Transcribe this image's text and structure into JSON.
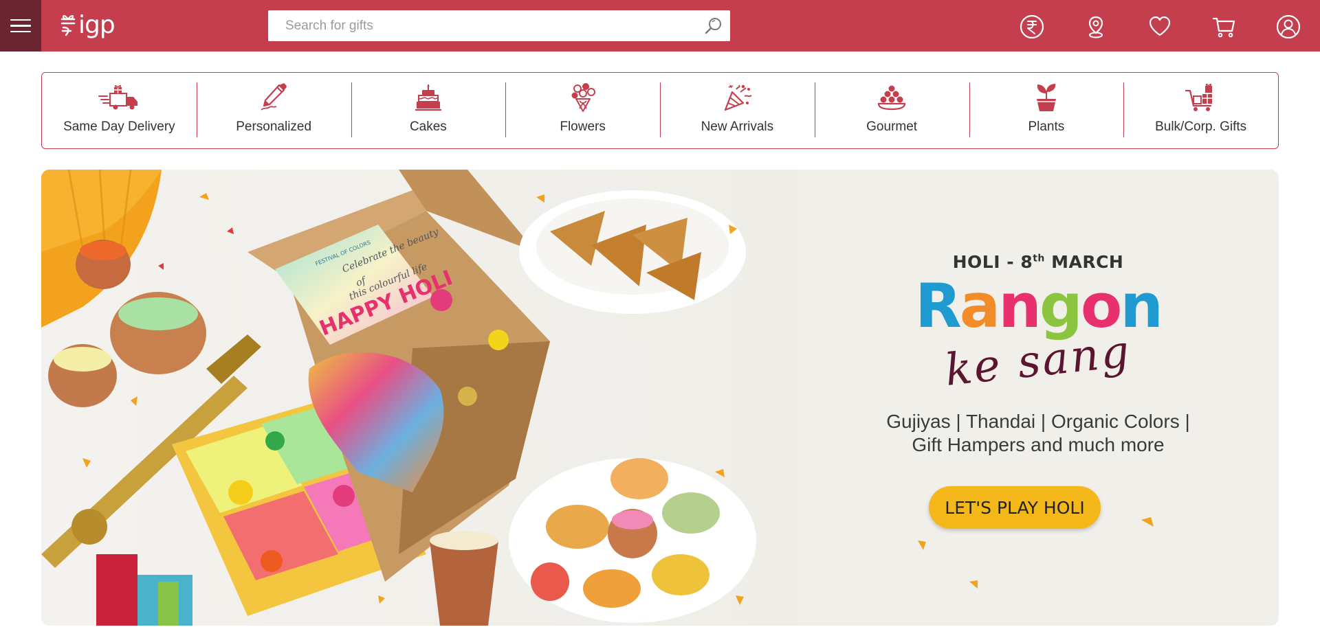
{
  "header": {
    "logo_text": "igp",
    "search": {
      "placeholder": "Search for gifts",
      "value": ""
    },
    "icons": [
      "menu-icon",
      "search-icon",
      "rupee-currency-icon",
      "location-pin-icon",
      "heart-icon",
      "cart-icon",
      "user-account-icon"
    ]
  },
  "categories": [
    {
      "label": "Same Day Delivery",
      "icon": "delivery-truck-icon"
    },
    {
      "label": "Personalized",
      "icon": "pencil-icon"
    },
    {
      "label": "Cakes",
      "icon": "cake-icon"
    },
    {
      "label": "Flowers",
      "icon": "bouquet-icon"
    },
    {
      "label": "New Arrivals",
      "icon": "party-popper-icon"
    },
    {
      "label": "Gourmet",
      "icon": "sweets-platter-icon"
    },
    {
      "label": "Plants",
      "icon": "potted-plant-icon"
    },
    {
      "label": "Bulk/Corp. Gifts",
      "icon": "gift-cart-icon"
    }
  ],
  "banner": {
    "date_line": "HOLI - 8",
    "date_suffix": "th",
    "date_month": "MARCH",
    "headline": "Rangon",
    "script_line": "ke sang",
    "description_line1": "Gujiyas | Thandai | Organic Colors |",
    "description_line2": "Gift Hampers and much more",
    "cta_label": "LET'S PLAY HOLI",
    "box_card_line1": "Celebrate the beauty",
    "box_card_line2": "of",
    "box_card_line3": "this colourful life",
    "box_card_title": "HAPPY HOLI",
    "box_card_brand": "FESTIVAL OF COLORS",
    "headline_colors": [
      "#1f9bd1",
      "#f28c28",
      "#e8306f",
      "#8bc43f",
      "#e8306f",
      "#1f9bd1"
    ],
    "accent": "#c43e4e",
    "cta_color": "#f5b81b"
  }
}
